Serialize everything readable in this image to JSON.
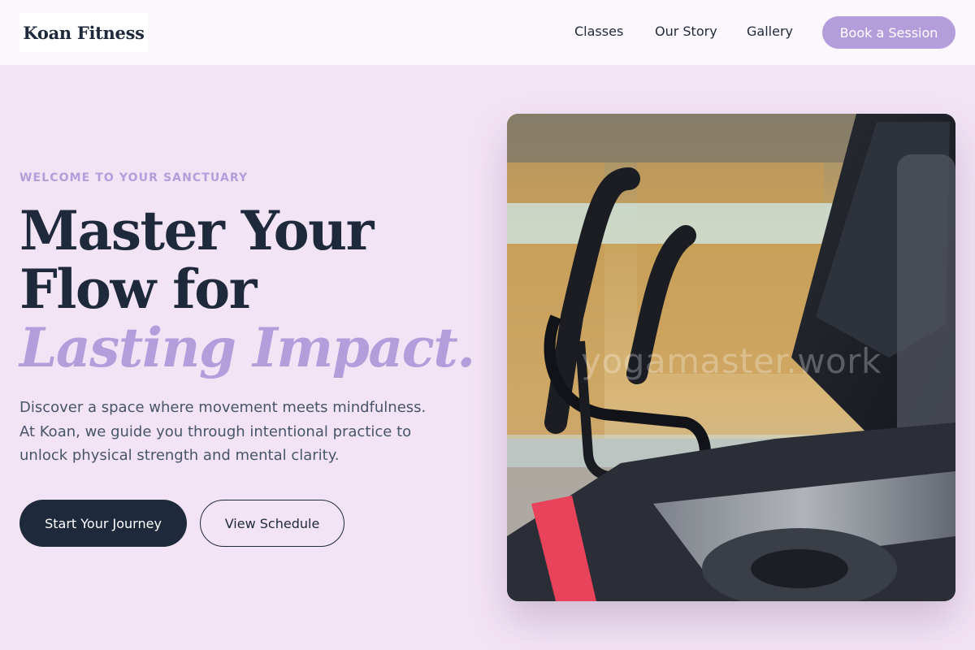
{
  "brand": {
    "logo_text": "Koan Fitness"
  },
  "nav": {
    "items": [
      {
        "label": "Classes"
      },
      {
        "label": "Our Story"
      },
      {
        "label": "Gallery"
      }
    ],
    "cta_label": "Book a Session"
  },
  "hero": {
    "eyebrow": "WELCOME TO YOUR SANCTUARY",
    "headline_part1": "Master Your Flow for ",
    "headline_accent": "Lasting Impact.",
    "description": "Discover a space where movement meets mindfulness. At Koan, we guide you through intentional practice to unlock physical strength and mental clarity.",
    "primary_button": "Start Your Journey",
    "secondary_button": "View Schedule",
    "image_watermark": "yogamaster.work"
  },
  "colors": {
    "background": "#f3e4f5",
    "header": "#fbf7fc",
    "accent": "#b39ddb",
    "dark": "#1e293b"
  }
}
